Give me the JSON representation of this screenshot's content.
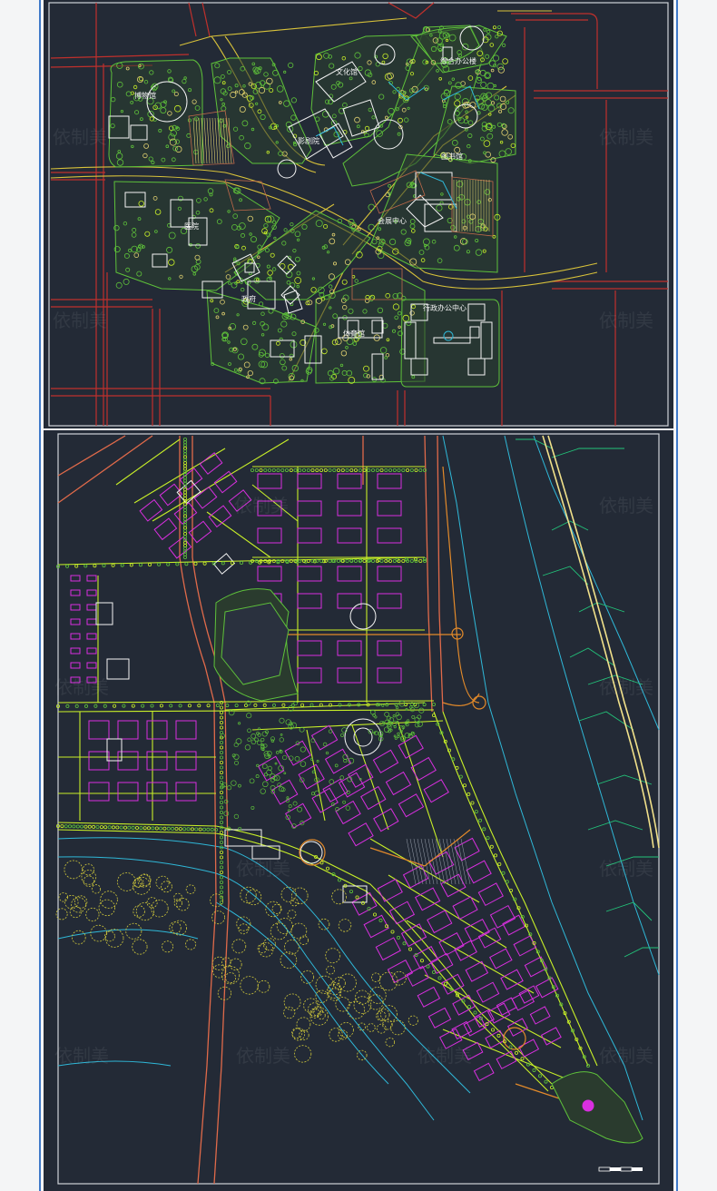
{
  "top_plan": {
    "labels": {
      "museum": "博物馆",
      "culture_hall": "文化馆",
      "office_center": "综合办公楼",
      "theater": "影剧院",
      "library": "图书馆",
      "hospital": "医院",
      "convention_center": "会展中心",
      "government": "政府",
      "admin_office_center": "行政办公中心",
      "gymnasium": "体育馆"
    }
  },
  "watermark": "依制美",
  "colors": {
    "page_bg": "#f4f5f6",
    "cad_bg": "#232a36",
    "frame_line": "#3f79c8",
    "road_red": "#c0302c",
    "road_yellow": "#d8c23a",
    "green": "#5ec13a",
    "yellow_green": "#c8ef28",
    "magenta": "#d92fe0",
    "cyan": "#2fb8d8",
    "white": "#f4f4f4",
    "orange": "#e38a2a"
  }
}
